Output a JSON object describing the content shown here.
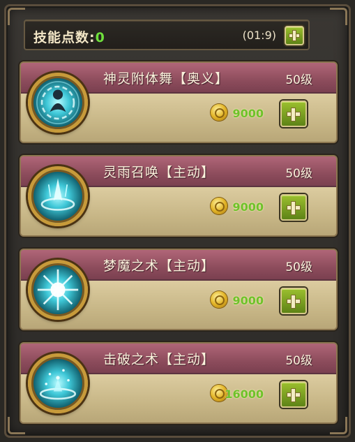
{
  "header": {
    "label": "技能点数:",
    "points": "0",
    "timer": "(01:9)"
  },
  "skills": [
    {
      "name": "神灵附体舞【奥义】",
      "level": "50级",
      "cost": "9000",
      "icon": "spirit-dance-icon"
    },
    {
      "name": "灵雨召唤【主动】",
      "level": "50级",
      "cost": "9000",
      "icon": "spirit-rain-icon"
    },
    {
      "name": "梦魔之术【主动】",
      "level": "50级",
      "cost": "9000",
      "icon": "nightmare-icon"
    },
    {
      "name": "击破之术【主动】",
      "level": "50级",
      "cost": "16000",
      "icon": "break-icon"
    }
  ],
  "colors": {
    "accent_green": "#6ec22a",
    "band_red": "#8d4c5c",
    "parchment": "#c9b98e"
  }
}
